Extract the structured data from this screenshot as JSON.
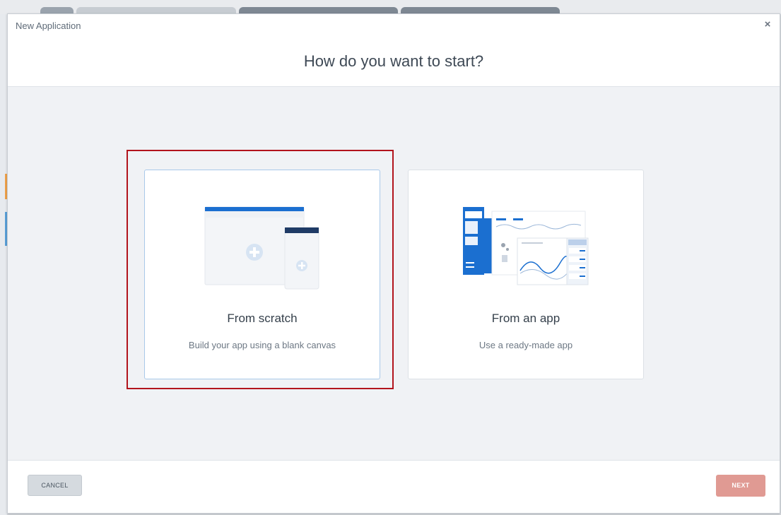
{
  "dialog": {
    "label": "New Application",
    "title": "How do you want to start?",
    "close_glyph": "×"
  },
  "options": [
    {
      "title": "From scratch",
      "description": "Build your app using a blank canvas",
      "illustration": "blank-canvas-illustration",
      "selected": true
    },
    {
      "title": "From an app",
      "description": "Use a ready-made app",
      "illustration": "ready-made-app-illustration",
      "selected": false
    }
  ],
  "footer": {
    "cancel_label": "CANCEL",
    "next_label": "NEXT"
  },
  "colors": {
    "accent_blue": "#1b6fd0",
    "highlight_red": "#b2141c",
    "next_button": "#e09a93"
  }
}
